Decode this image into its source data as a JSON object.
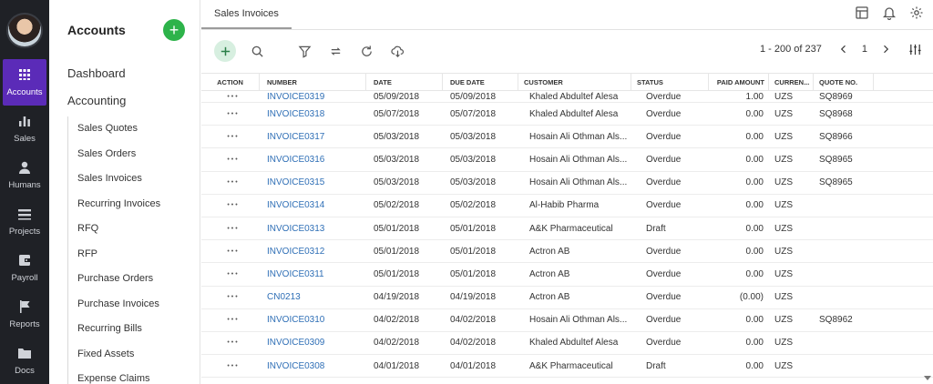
{
  "rail": {
    "items": [
      {
        "label": "Accounts",
        "icon": "grid-icon",
        "active": true
      },
      {
        "label": "Sales",
        "icon": "bar-chart-icon"
      },
      {
        "label": "Humans",
        "icon": "person-icon"
      },
      {
        "label": "Projects",
        "icon": "menu-lines-icon"
      },
      {
        "label": "Payroll",
        "icon": "wallet-icon"
      },
      {
        "label": "Reports",
        "icon": "flag-icon"
      },
      {
        "label": "Docs",
        "icon": "folder-icon"
      }
    ],
    "accent": "#5b2bb8"
  },
  "sidebar": {
    "title": "Accounts",
    "top_items": [
      "Dashboard",
      "Accounting"
    ],
    "sub_items": [
      "Sales Quotes",
      "Sales Orders",
      "Sales Invoices",
      "Recurring Invoices",
      "RFQ",
      "RFP",
      "Purchase Orders",
      "Purchase Invoices",
      "Recurring Bills",
      "Fixed Assets",
      "Expense Claims"
    ]
  },
  "tabs": {
    "active": "Sales Invoices"
  },
  "pager": {
    "range": "1 - 200 of 237",
    "page": "1"
  },
  "table": {
    "headers": {
      "action": "ACTION",
      "number": "NUMBER",
      "date": "DATE",
      "due": "DUE DATE",
      "customer": "CUSTOMER",
      "status": "STATUS",
      "paid": "PAID AMOUNT",
      "currency": "CURREN...",
      "quote": "QUOTE NO."
    },
    "rows": [
      {
        "number": "INVOICE0319",
        "date": "05/09/2018",
        "due": "05/09/2018",
        "customer": "Khaled Abdultef Alesa",
        "status": "Overdue",
        "paid": "1.00",
        "currency": "UZS",
        "quote": "SQ8969"
      },
      {
        "number": "INVOICE0318",
        "date": "05/07/2018",
        "due": "05/07/2018",
        "customer": "Khaled Abdultef Alesa",
        "status": "Overdue",
        "paid": "0.00",
        "currency": "UZS",
        "quote": "SQ8968"
      },
      {
        "number": "INVOICE0317",
        "date": "05/03/2018",
        "due": "05/03/2018",
        "customer": "Hosain Ali Othman Als...",
        "status": "Overdue",
        "paid": "0.00",
        "currency": "UZS",
        "quote": "SQ8966"
      },
      {
        "number": "INVOICE0316",
        "date": "05/03/2018",
        "due": "05/03/2018",
        "customer": "Hosain Ali Othman Als...",
        "status": "Overdue",
        "paid": "0.00",
        "currency": "UZS",
        "quote": "SQ8965"
      },
      {
        "number": "INVOICE0315",
        "date": "05/03/2018",
        "due": "05/03/2018",
        "customer": "Hosain Ali Othman Als...",
        "status": "Overdue",
        "paid": "0.00",
        "currency": "UZS",
        "quote": "SQ8965"
      },
      {
        "number": "INVOICE0314",
        "date": "05/02/2018",
        "due": "05/02/2018",
        "customer": "Al-Habib Pharma",
        "status": "Overdue",
        "paid": "0.00",
        "currency": "UZS",
        "quote": ""
      },
      {
        "number": "INVOICE0313",
        "date": "05/01/2018",
        "due": "05/01/2018",
        "customer": "A&K Pharmaceutical",
        "status": "Draft",
        "paid": "0.00",
        "currency": "UZS",
        "quote": ""
      },
      {
        "number": "INVOICE0312",
        "date": "05/01/2018",
        "due": "05/01/2018",
        "customer": "Actron AB",
        "status": "Overdue",
        "paid": "0.00",
        "currency": "UZS",
        "quote": ""
      },
      {
        "number": "INVOICE0311",
        "date": "05/01/2018",
        "due": "05/01/2018",
        "customer": "Actron AB",
        "status": "Overdue",
        "paid": "0.00",
        "currency": "UZS",
        "quote": ""
      },
      {
        "number": "CN0213",
        "date": "04/19/2018",
        "due": "04/19/2018",
        "customer": "Actron AB",
        "status": "Overdue",
        "paid": "(0.00)",
        "currency": "UZS",
        "quote": ""
      },
      {
        "number": "INVOICE0310",
        "date": "04/02/2018",
        "due": "04/02/2018",
        "customer": "Hosain Ali Othman Als...",
        "status": "Overdue",
        "paid": "0.00",
        "currency": "UZS",
        "quote": "SQ8962"
      },
      {
        "number": "INVOICE0309",
        "date": "04/02/2018",
        "due": "04/02/2018",
        "customer": "Khaled Abdultef Alesa",
        "status": "Overdue",
        "paid": "0.00",
        "currency": "UZS",
        "quote": ""
      },
      {
        "number": "INVOICE0308",
        "date": "04/01/2018",
        "due": "04/01/2018",
        "customer": "A&K Pharmaceutical",
        "status": "Draft",
        "paid": "0.00",
        "currency": "UZS",
        "quote": ""
      }
    ]
  },
  "colors": {
    "link": "#2f6fb6",
    "add_green": "#2db34a"
  }
}
